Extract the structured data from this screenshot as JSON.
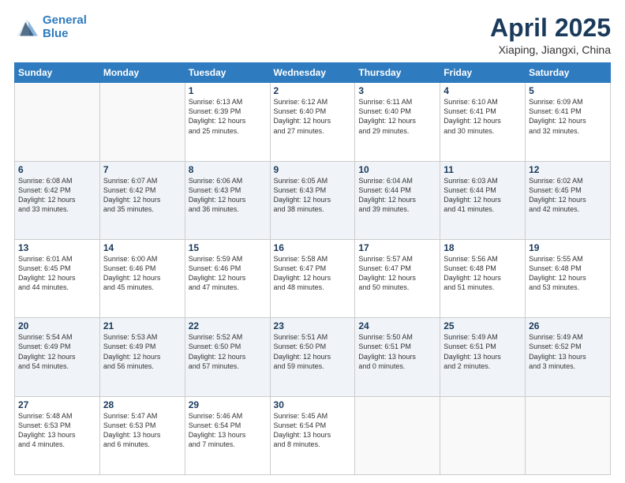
{
  "logo": {
    "line1": "General",
    "line2": "Blue"
  },
  "title": "April 2025",
  "subtitle": "Xiaping, Jiangxi, China",
  "header_days": [
    "Sunday",
    "Monday",
    "Tuesday",
    "Wednesday",
    "Thursday",
    "Friday",
    "Saturday"
  ],
  "weeks": [
    [
      {
        "day": "",
        "text": ""
      },
      {
        "day": "",
        "text": ""
      },
      {
        "day": "1",
        "text": "Sunrise: 6:13 AM\nSunset: 6:39 PM\nDaylight: 12 hours\nand 25 minutes."
      },
      {
        "day": "2",
        "text": "Sunrise: 6:12 AM\nSunset: 6:40 PM\nDaylight: 12 hours\nand 27 minutes."
      },
      {
        "day": "3",
        "text": "Sunrise: 6:11 AM\nSunset: 6:40 PM\nDaylight: 12 hours\nand 29 minutes."
      },
      {
        "day": "4",
        "text": "Sunrise: 6:10 AM\nSunset: 6:41 PM\nDaylight: 12 hours\nand 30 minutes."
      },
      {
        "day": "5",
        "text": "Sunrise: 6:09 AM\nSunset: 6:41 PM\nDaylight: 12 hours\nand 32 minutes."
      }
    ],
    [
      {
        "day": "6",
        "text": "Sunrise: 6:08 AM\nSunset: 6:42 PM\nDaylight: 12 hours\nand 33 minutes."
      },
      {
        "day": "7",
        "text": "Sunrise: 6:07 AM\nSunset: 6:42 PM\nDaylight: 12 hours\nand 35 minutes."
      },
      {
        "day": "8",
        "text": "Sunrise: 6:06 AM\nSunset: 6:43 PM\nDaylight: 12 hours\nand 36 minutes."
      },
      {
        "day": "9",
        "text": "Sunrise: 6:05 AM\nSunset: 6:43 PM\nDaylight: 12 hours\nand 38 minutes."
      },
      {
        "day": "10",
        "text": "Sunrise: 6:04 AM\nSunset: 6:44 PM\nDaylight: 12 hours\nand 39 minutes."
      },
      {
        "day": "11",
        "text": "Sunrise: 6:03 AM\nSunset: 6:44 PM\nDaylight: 12 hours\nand 41 minutes."
      },
      {
        "day": "12",
        "text": "Sunrise: 6:02 AM\nSunset: 6:45 PM\nDaylight: 12 hours\nand 42 minutes."
      }
    ],
    [
      {
        "day": "13",
        "text": "Sunrise: 6:01 AM\nSunset: 6:45 PM\nDaylight: 12 hours\nand 44 minutes."
      },
      {
        "day": "14",
        "text": "Sunrise: 6:00 AM\nSunset: 6:46 PM\nDaylight: 12 hours\nand 45 minutes."
      },
      {
        "day": "15",
        "text": "Sunrise: 5:59 AM\nSunset: 6:46 PM\nDaylight: 12 hours\nand 47 minutes."
      },
      {
        "day": "16",
        "text": "Sunrise: 5:58 AM\nSunset: 6:47 PM\nDaylight: 12 hours\nand 48 minutes."
      },
      {
        "day": "17",
        "text": "Sunrise: 5:57 AM\nSunset: 6:47 PM\nDaylight: 12 hours\nand 50 minutes."
      },
      {
        "day": "18",
        "text": "Sunrise: 5:56 AM\nSunset: 6:48 PM\nDaylight: 12 hours\nand 51 minutes."
      },
      {
        "day": "19",
        "text": "Sunrise: 5:55 AM\nSunset: 6:48 PM\nDaylight: 12 hours\nand 53 minutes."
      }
    ],
    [
      {
        "day": "20",
        "text": "Sunrise: 5:54 AM\nSunset: 6:49 PM\nDaylight: 12 hours\nand 54 minutes."
      },
      {
        "day": "21",
        "text": "Sunrise: 5:53 AM\nSunset: 6:49 PM\nDaylight: 12 hours\nand 56 minutes."
      },
      {
        "day": "22",
        "text": "Sunrise: 5:52 AM\nSunset: 6:50 PM\nDaylight: 12 hours\nand 57 minutes."
      },
      {
        "day": "23",
        "text": "Sunrise: 5:51 AM\nSunset: 6:50 PM\nDaylight: 12 hours\nand 59 minutes."
      },
      {
        "day": "24",
        "text": "Sunrise: 5:50 AM\nSunset: 6:51 PM\nDaylight: 13 hours\nand 0 minutes."
      },
      {
        "day": "25",
        "text": "Sunrise: 5:49 AM\nSunset: 6:51 PM\nDaylight: 13 hours\nand 2 minutes."
      },
      {
        "day": "26",
        "text": "Sunrise: 5:49 AM\nSunset: 6:52 PM\nDaylight: 13 hours\nand 3 minutes."
      }
    ],
    [
      {
        "day": "27",
        "text": "Sunrise: 5:48 AM\nSunset: 6:53 PM\nDaylight: 13 hours\nand 4 minutes."
      },
      {
        "day": "28",
        "text": "Sunrise: 5:47 AM\nSunset: 6:53 PM\nDaylight: 13 hours\nand 6 minutes."
      },
      {
        "day": "29",
        "text": "Sunrise: 5:46 AM\nSunset: 6:54 PM\nDaylight: 13 hours\nand 7 minutes."
      },
      {
        "day": "30",
        "text": "Sunrise: 5:45 AM\nSunset: 6:54 PM\nDaylight: 13 hours\nand 8 minutes."
      },
      {
        "day": "",
        "text": ""
      },
      {
        "day": "",
        "text": ""
      },
      {
        "day": "",
        "text": ""
      }
    ]
  ]
}
